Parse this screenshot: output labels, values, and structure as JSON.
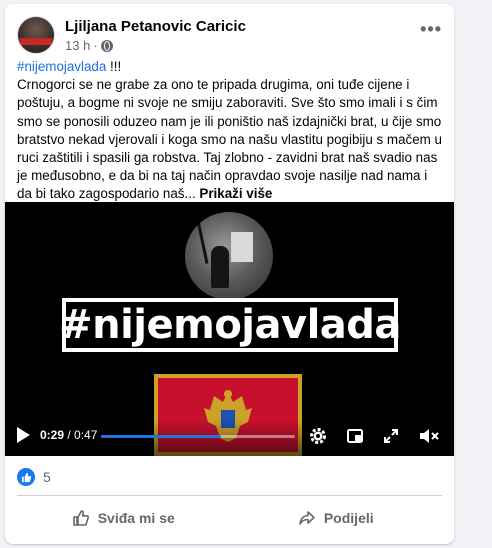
{
  "post": {
    "author": "Ljiljana Petanovic Caricic",
    "time": "13 h",
    "separator": "·",
    "more_label": "•••",
    "hashtag": "#nijemojavlada",
    "hashtag_suffix": " !!!",
    "body": "Crnogorci se ne grabe za ono te pripada drugima, oni tuđe cijene i poštuju, a bogme ni svoje ne smiju zaboraviti. Sve što smo imali i s čim smo se ponosili oduzeo nam je ili poništio naš izdajnički brat, u čije smo bratstvo nekad vjerovali i koga smo na našu vlastitu pogibiju s mačem u ruci zaštitili i spasili ga robstva. Taj zlobno - zavidni brat naš svadio nas je međusobno, e da bi na taj način opravdao svoje nasilje nad nama i da bi tako zagospodario naš...",
    "see_more": "Prikaži više"
  },
  "video": {
    "overlay_title": "#nijemojavlada",
    "current_time": "0:29",
    "time_separator": " / ",
    "duration": "0:47",
    "progress": 0.617,
    "accent_color": "#2374e1",
    "icons": [
      "play-icon",
      "settings-icon",
      "mini-player-icon",
      "fullscreen-icon",
      "mute-icon"
    ]
  },
  "reactions": {
    "count": "5",
    "icon": "like-icon",
    "color": "#1877f2"
  },
  "actions": {
    "like_label": "Sviđa mi se",
    "share_label": "Podijeli"
  }
}
